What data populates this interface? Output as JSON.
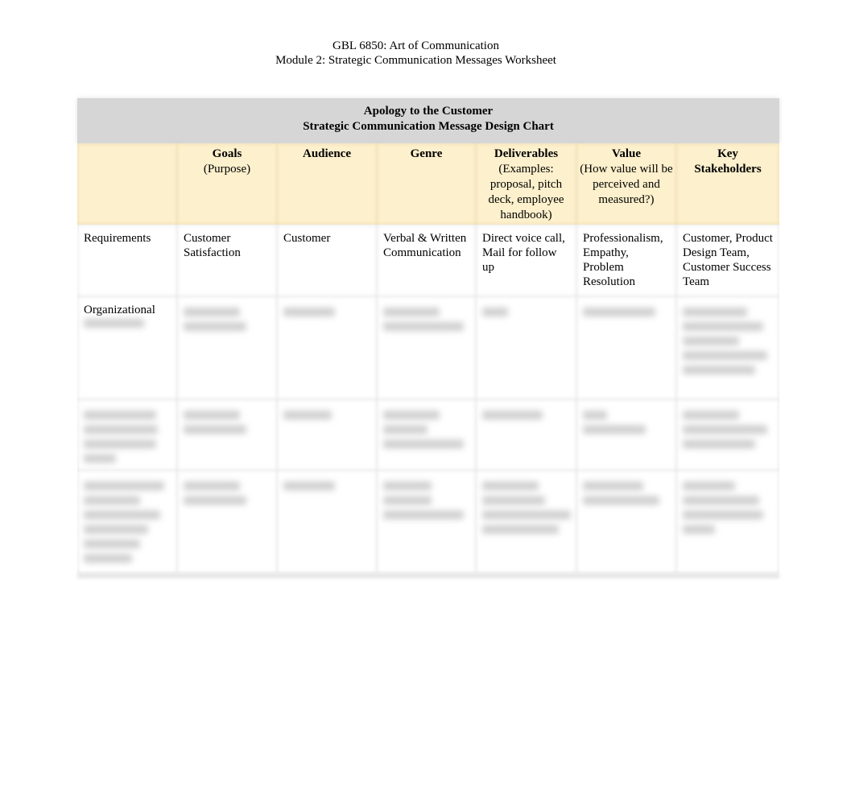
{
  "document": {
    "course_title": "GBL 6850: Art of Communication",
    "module_title": "Module 2: Strategic Communication Messages Worksheet"
  },
  "chart": {
    "title_line1": "Apology to the Customer",
    "title_line2": "Strategic Communication Message Design Chart",
    "columns": [
      {
        "title": "",
        "subtitle": ""
      },
      {
        "title": "Goals",
        "subtitle": "(Purpose)"
      },
      {
        "title": "Audience",
        "subtitle": ""
      },
      {
        "title": "Genre",
        "subtitle": ""
      },
      {
        "title": "Deliverables",
        "subtitle": "(Examples: proposal, pitch deck, employee handbook)"
      },
      {
        "title": "Value",
        "subtitle": "(How value will be perceived and measured?)"
      },
      {
        "title": "Key Stakeholders",
        "subtitle": ""
      }
    ],
    "rows": [
      {
        "label": "Requirements",
        "cells": [
          "Customer Satisfaction",
          "Customer",
          "Verbal & Written Communication",
          "Direct voice call, Mail for follow up",
          "Professionalism, Empathy, Problem Resolution",
          "Customer, Product Design Team, Customer Success Team"
        ],
        "blurred": false
      },
      {
        "label": "Organizational",
        "cells": [
          "",
          "",
          "",
          "",
          "",
          ""
        ],
        "blurred": true
      },
      {
        "label": "",
        "cells": [
          "",
          "",
          "",
          "",
          "",
          ""
        ],
        "blurred": true
      },
      {
        "label": "",
        "cells": [
          "",
          "",
          "",
          "",
          "",
          ""
        ],
        "blurred": true
      }
    ]
  },
  "colors": {
    "title_band": "#d6d6d6",
    "header_band": "#fdf0cc"
  }
}
